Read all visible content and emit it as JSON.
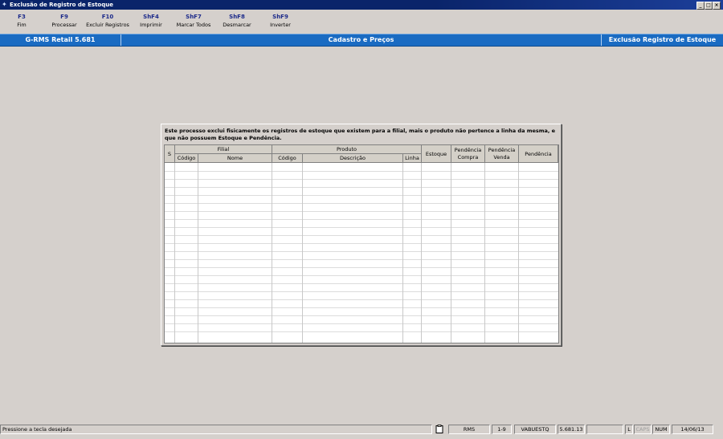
{
  "window": {
    "title": "Exclusão de Registro de Estoque"
  },
  "toolbar": [
    {
      "key": "F3",
      "label": "Fim"
    },
    {
      "key": "F9",
      "label": "Processar"
    },
    {
      "key": "F10",
      "label": "Excluir Registros"
    },
    {
      "key": "ShF4",
      "label": "Imprimir"
    },
    {
      "key": "ShF7",
      "label": "Marcar Todos"
    },
    {
      "key": "ShF8",
      "label": "Desmarcar"
    },
    {
      "key": "ShF9",
      "label": "Inverter"
    }
  ],
  "header": {
    "app": "G-RMS Retail 5.681",
    "module": "Cadastro e Preços",
    "screen": "Exclusão Registro de Estoque"
  },
  "panel": {
    "message": "Este processo exclui fisicamente os registros de estoque que existem para a filial, mais o produto não pertence a linha da mesma, e que não possuem Estoque e Pendência."
  },
  "grid": {
    "group_filial": "Filial",
    "group_produto": "Produto",
    "col_s": "S",
    "col_filial_codigo": "Código",
    "col_filial_nome": "Nome",
    "col_produto_codigo": "Código",
    "col_descricao": "Descrição",
    "col_linha": "Linha",
    "col_estoque": "Estoque",
    "col_pend_compra": "Pendência Compra",
    "col_pend_venda": "Pendência Venda",
    "col_pendencia": "Pendência",
    "rows": []
  },
  "statusbar": {
    "message": "Pressione a tecla desejada",
    "system": "RMS",
    "range": "1-9",
    "program": "VABUESTQ",
    "version": "5.681.13",
    "l": "L",
    "caps": "CAPS",
    "num": "NUM",
    "date": "14/06/13"
  }
}
